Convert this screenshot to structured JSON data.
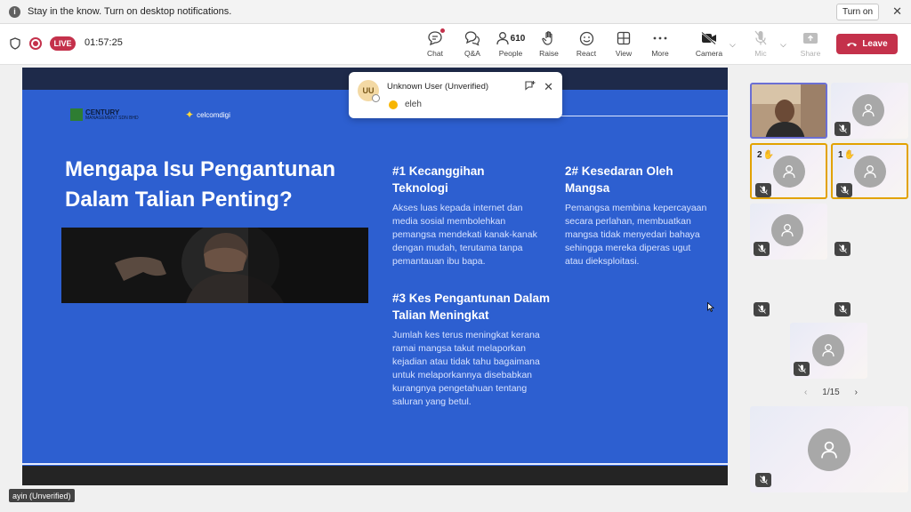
{
  "notification": {
    "message": "Stay in the know. Turn on desktop notifications.",
    "turn_on_label": "Turn on"
  },
  "toolbar": {
    "live_label": "LIVE",
    "timer": "01:57:25",
    "people_count": "610",
    "buttons": {
      "chat": "Chat",
      "qa": "Q&A",
      "people": "People",
      "raise": "Raise",
      "react": "React",
      "view": "View",
      "more": "More",
      "camera": "Camera",
      "mic": "Mic",
      "share": "Share"
    },
    "leave_label": "Leave",
    "colors": {
      "leave": "#c4314b",
      "live": "#c4314b"
    }
  },
  "slide": {
    "logo_left": "CENTURY",
    "logo_left_sub": "MANAGEMENT SDN BHD",
    "logo_right": "celcomdigi",
    "title": "Mengapa Isu Pengantunan Dalam Talian Penting?",
    "points": [
      {
        "heading": "#1 Kecanggihan Teknologi",
        "body": "Akses luas kepada internet dan media sosial membolehkan pemangsa mendekati kanak-kanak dengan mudah, terutama tanpa pemantauan ibu bapa."
      },
      {
        "heading": "2# Kesedaran Oleh Mangsa",
        "body": "Pemangsa membina kepercayaan secara perlahan, membuatkan mangsa tidak menyedari bahaya sehingga mereka diperas ugut atau dieksploitasi."
      },
      {
        "heading": "#3 Kes Pengantunan Dalam Talian Meningkat",
        "body": "Jumlah kes terus meningkat kerana ramai mangsa takut melaporkan kejadian atau tidak tahu bagaimana untuk melaporkannya disebabkan kurangnya pengetahuan tentang saluran yang betul."
      }
    ],
    "colors": {
      "background": "#2d5fd0"
    }
  },
  "chat_toast": {
    "initials": "UU",
    "sender": "Unknown User (Unverified)",
    "message": "eleh"
  },
  "presenter_label": "ayin (Unverified)",
  "gallery": {
    "hand_counts": [
      "2",
      "1"
    ],
    "pager": "1/15"
  }
}
